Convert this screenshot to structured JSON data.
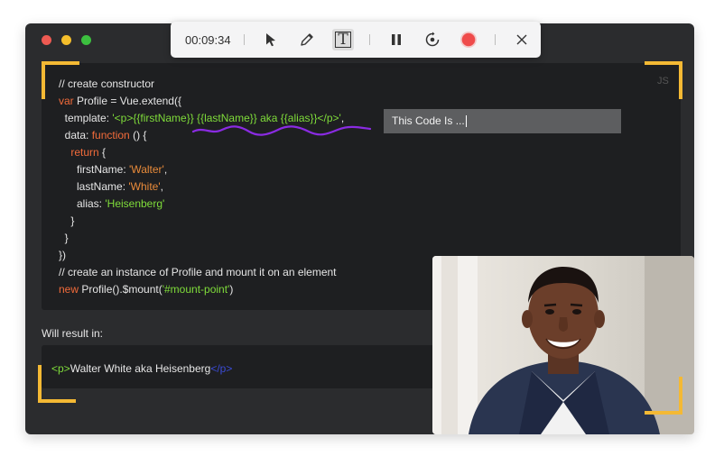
{
  "toolbar": {
    "timer": "00:09:34",
    "tools": [
      {
        "name": "cursor-icon"
      },
      {
        "name": "pen-icon"
      },
      {
        "name": "text-tool-icon",
        "active": true
      },
      {
        "name": "pause-icon"
      },
      {
        "name": "webcam-toggle-icon"
      },
      {
        "name": "record-icon"
      },
      {
        "name": "close-icon"
      }
    ],
    "text_tool_glyph": "T"
  },
  "code": {
    "language": "JS",
    "lines": [
      {
        "parts": [
          {
            "t": "// create constructor",
            "c": ""
          }
        ]
      },
      {
        "parts": [
          {
            "t": "var",
            "c": "k"
          },
          {
            "t": " Profile = Vue.extend({",
            "c": ""
          }
        ]
      },
      {
        "parts": [
          {
            "t": "  template: ",
            "c": ""
          },
          {
            "t": "'<p>{{firstName}} {{lastName}} aka {{alias}}</p>'",
            "c": "g"
          },
          {
            "t": ",",
            "c": ""
          }
        ]
      },
      {
        "parts": [
          {
            "t": "  data: ",
            "c": ""
          },
          {
            "t": "function",
            "c": "k"
          },
          {
            "t": " () {",
            "c": ""
          }
        ]
      },
      {
        "parts": [
          {
            "t": "    ",
            "c": ""
          },
          {
            "t": "return",
            "c": "k"
          },
          {
            "t": " {",
            "c": ""
          }
        ]
      },
      {
        "parts": [
          {
            "t": "      firstName: ",
            "c": ""
          },
          {
            "t": "'Walter'",
            "c": "s"
          },
          {
            "t": ",",
            "c": ""
          }
        ]
      },
      {
        "parts": [
          {
            "t": "      lastName: ",
            "c": ""
          },
          {
            "t": "'White'",
            "c": "s"
          },
          {
            "t": ",",
            "c": ""
          }
        ]
      },
      {
        "parts": [
          {
            "t": "      alias: ",
            "c": ""
          },
          {
            "t": "'Heisenberg'",
            "c": "g"
          }
        ]
      },
      {
        "parts": [
          {
            "t": "    }",
            "c": ""
          }
        ]
      },
      {
        "parts": [
          {
            "t": "  }",
            "c": ""
          }
        ]
      },
      {
        "parts": [
          {
            "t": "})",
            "c": ""
          }
        ]
      },
      {
        "parts": [
          {
            "t": "// create an instance of Profile and mount it on an element",
            "c": ""
          }
        ]
      },
      {
        "parts": [
          {
            "t": "new",
            "c": "k"
          },
          {
            "t": " Profile().$mount(",
            "c": ""
          },
          {
            "t": "'#mount-point'",
            "c": "g"
          },
          {
            "t": ")",
            "c": ""
          }
        ]
      }
    ]
  },
  "annotation": {
    "text": "This Code Is ..."
  },
  "result": {
    "label": "Will result in:",
    "open_tag": "<p>",
    "content": "Walter White aka Heisenberg",
    "close_tag": "</p>"
  },
  "colors": {
    "keyword": "#f26b3a",
    "string_green": "#7fdc3a",
    "string_orange": "#e98b3a",
    "corner_bracket": "#f4b934",
    "squiggle": "#8a2be2",
    "record": "#ef4b4b"
  }
}
